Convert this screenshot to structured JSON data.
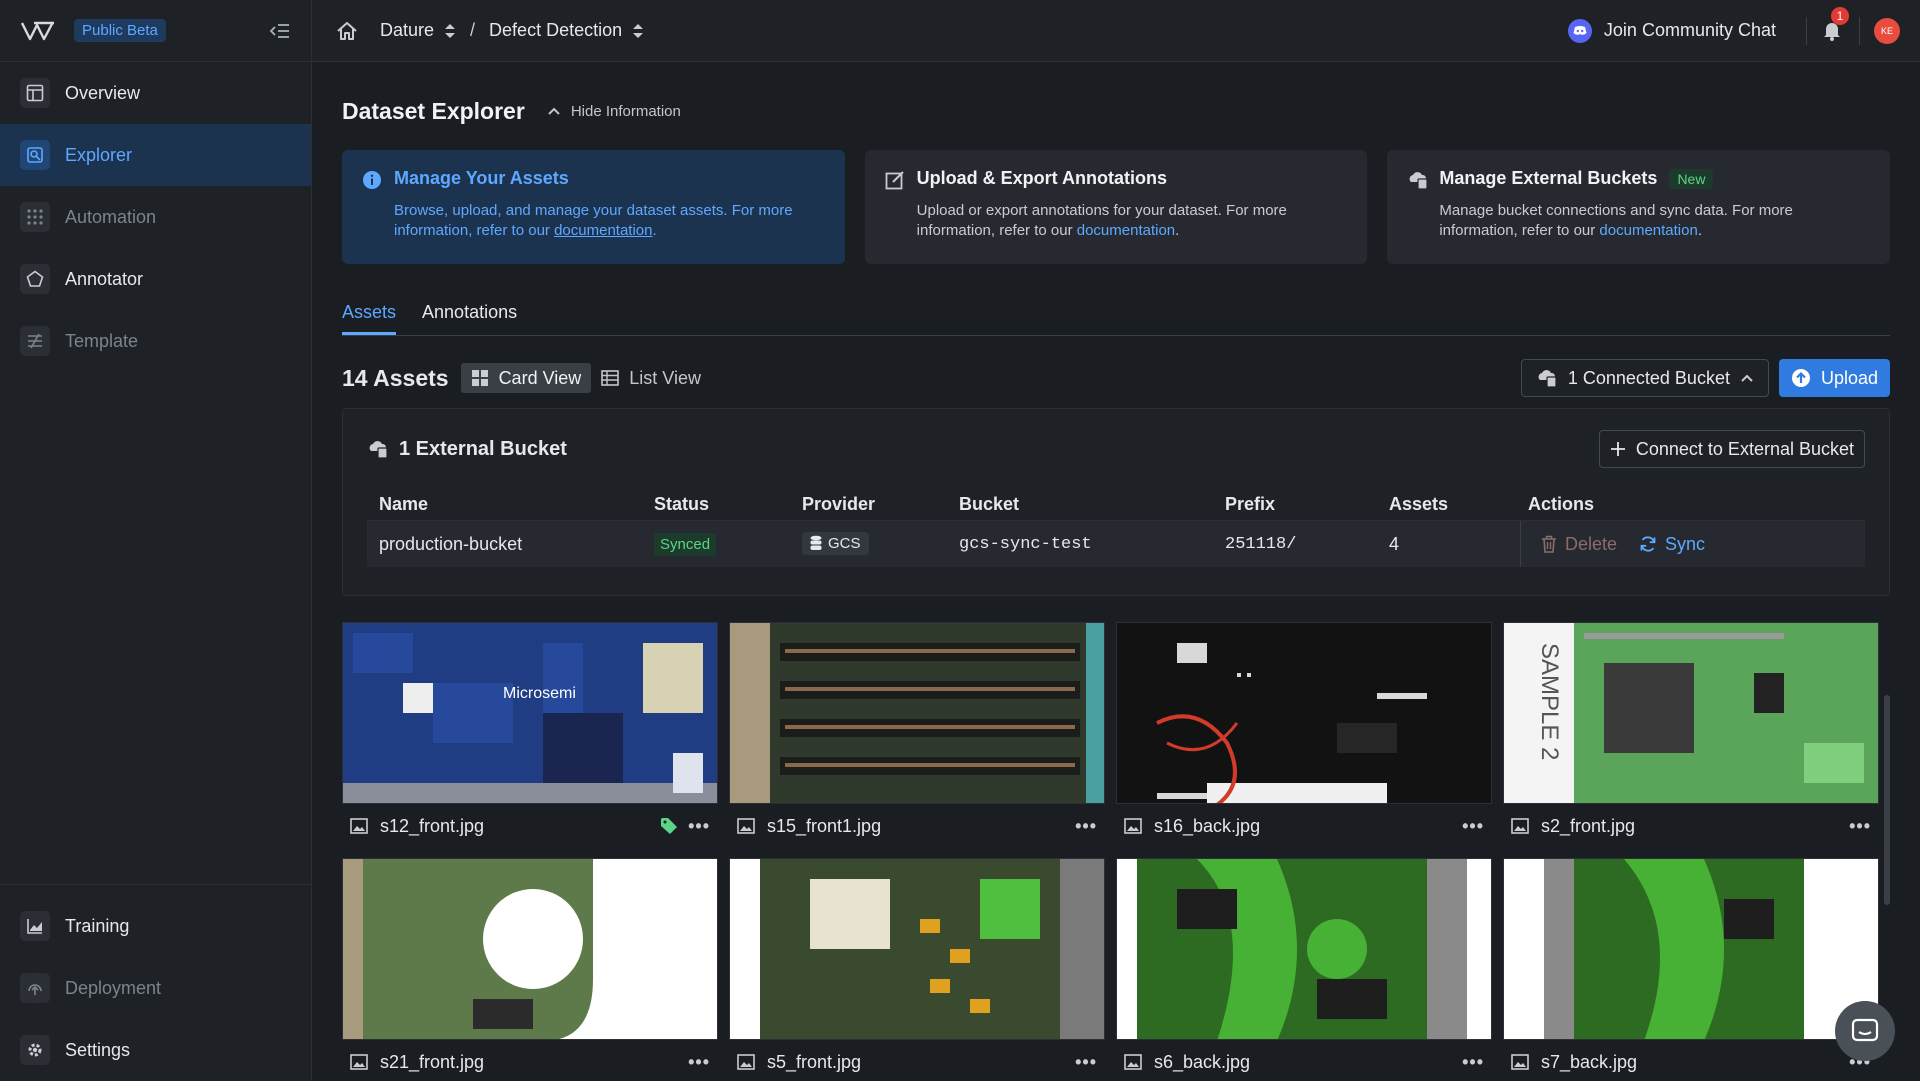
{
  "sidebar": {
    "beta_badge": "Public Beta",
    "items": [
      {
        "label": "Overview"
      },
      {
        "label": "Explorer"
      },
      {
        "label": "Automation"
      },
      {
        "label": "Annotator"
      },
      {
        "label": "Template"
      }
    ],
    "bottom_items": [
      {
        "label": "Training"
      },
      {
        "label": "Deployment"
      },
      {
        "label": "Settings"
      }
    ]
  },
  "topbar": {
    "breadcrumb": [
      "Dature",
      "Defect Detection"
    ],
    "separator": "/",
    "community_label": "Join Community Chat",
    "notification_count": "1",
    "avatar_initials": "KE"
  },
  "section": {
    "title": "Dataset Explorer",
    "hide_label": "Hide Information"
  },
  "info_cards": [
    {
      "title": "Manage Your Assets",
      "text": "Browse, upload, and manage your dataset assets. For more information, refer to our ",
      "link": "documentation",
      "tail": "."
    },
    {
      "title": "Upload & Export Annotations",
      "text": "Upload or export annotations for your dataset. For more information, refer to our ",
      "link": "documentation",
      "tail": "."
    },
    {
      "title": "Manage External Buckets",
      "badge": "New",
      "text": "Manage bucket connections and sync data. For more information, refer to our ",
      "link": "documentation",
      "tail": "."
    }
  ],
  "tabs": [
    "Assets",
    "Annotations"
  ],
  "assets_bar": {
    "count_label": "14 Assets",
    "card_view": "Card View",
    "list_view": "List View",
    "bucket_button": "1 Connected Bucket",
    "upload_button": "Upload"
  },
  "external": {
    "title": "1 External Bucket",
    "connect_button": "Connect to External Bucket",
    "columns": [
      "Name",
      "Status",
      "Provider",
      "Bucket",
      "Prefix",
      "Assets",
      "Actions"
    ],
    "row": {
      "name": "production-bucket",
      "status": "Synced",
      "provider": "GCS",
      "bucket": "gcs-sync-test",
      "prefix": "251118/",
      "assets": "4",
      "delete_label": "Delete",
      "sync_label": "Sync"
    }
  },
  "cards": [
    {
      "name": "s12_front.jpg",
      "tagged": true
    },
    {
      "name": "s15_front1.jpg"
    },
    {
      "name": "s16_back.jpg"
    },
    {
      "name": "s2_front.jpg"
    },
    {
      "name": "s21_front.jpg"
    },
    {
      "name": "s5_front.jpg"
    },
    {
      "name": "s6_back.jpg"
    },
    {
      "name": "s7_back.jpg"
    }
  ],
  "card_menu": "•••",
  "colors": {
    "accent": "#2f7be0",
    "link": "#5ea8ff",
    "success": "#5bd48a",
    "danger": "#e53935"
  }
}
